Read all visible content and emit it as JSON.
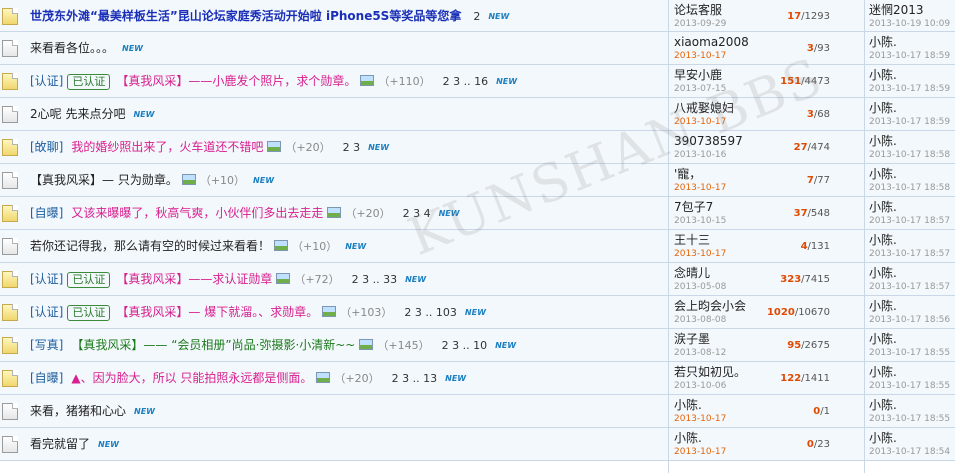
{
  "watermark": "KUNSHAN BBS",
  "threads": [
    {
      "icon": "folder-icon",
      "category": "",
      "badge": "",
      "title": "世茂东外滩“最美样板生活”昆山论坛家庭秀活动开始啦 iPhone5S等奖品等您拿",
      "title_color": "blue",
      "has_image": false,
      "replies_label": "",
      "pages": "2",
      "new": "NEW",
      "author": "论坛客服",
      "author_date": "2013-09-29",
      "author_date_hot": false,
      "reply_count": "17",
      "view_count": "1293",
      "last_user": "迷惘2013",
      "last_time": "2013-10-19 10:09"
    },
    {
      "icon": "page-icon",
      "category": "",
      "badge": "",
      "title": "来看看各位。。。",
      "title_color": "dark",
      "has_image": false,
      "replies_label": "",
      "pages": "",
      "new": "NEW",
      "author": "xiaoma2008",
      "author_date": "2013-10-17",
      "author_date_hot": true,
      "reply_count": "3",
      "view_count": "93",
      "last_user": "小陈.",
      "last_time": "2013-10-17 18:59"
    },
    {
      "icon": "folder-icon",
      "category": "[认证]",
      "badge": "已认证",
      "title": "【真我风采】——小鹿发个照片，求个勋章。",
      "title_color": "pink",
      "has_image": true,
      "replies_label": "（+110）",
      "pages": "2 3 .. 16",
      "new": "NEW",
      "author": "早安小鹿",
      "author_date": "2013-07-15",
      "author_date_hot": false,
      "reply_count": "151",
      "view_count": "4473",
      "last_user": "小陈.",
      "last_time": "2013-10-17 18:59"
    },
    {
      "icon": "page-icon",
      "category": "",
      "badge": "",
      "title": "2心呢 先来点分吧",
      "title_color": "dark",
      "has_image": false,
      "replies_label": "",
      "pages": "",
      "new": "NEW",
      "author": "八戒娶媳妇",
      "author_date": "2013-10-17",
      "author_date_hot": true,
      "reply_count": "3",
      "view_count": "68",
      "last_user": "小陈.",
      "last_time": "2013-10-17 18:59"
    },
    {
      "icon": "folder-icon",
      "category": "[敀聊]",
      "badge": "",
      "title": "我的婚纱照出来了，火车道还不错吧",
      "title_color": "pink",
      "has_image": true,
      "replies_label": "（+20）",
      "pages": "2 3",
      "new": "NEW",
      "author": "390738597",
      "author_date": "2013-10-16",
      "author_date_hot": false,
      "reply_count": "27",
      "view_count": "474",
      "last_user": "小陈.",
      "last_time": "2013-10-17 18:58"
    },
    {
      "icon": "page-icon",
      "category": "",
      "badge": "",
      "title": "【真我风采】— 只为勋章。",
      "title_color": "dark",
      "has_image": true,
      "replies_label": "（+10）",
      "pages": "",
      "new": "NEW",
      "author": "'寵，",
      "author_date": "2013-10-17",
      "author_date_hot": true,
      "reply_count": "7",
      "view_count": "77",
      "last_user": "小陈.",
      "last_time": "2013-10-17 18:58"
    },
    {
      "icon": "folder-icon",
      "category": "[自曝]",
      "badge": "",
      "title": "又该来曝曝了，秋高气爽，小伙伴们多出去走走",
      "title_color": "pink",
      "has_image": true,
      "replies_label": "（+20）",
      "pages": "2 3 4",
      "new": "NEW",
      "author": "7包子7",
      "author_date": "2013-10-15",
      "author_date_hot": false,
      "reply_count": "37",
      "view_count": "548",
      "last_user": "小陈.",
      "last_time": "2013-10-17 18:57"
    },
    {
      "icon": "page-icon",
      "category": "",
      "badge": "",
      "title": "若你还记得我，那么请有空的时候过来看看！",
      "title_color": "dark",
      "has_image": true,
      "replies_label": "（+10）",
      "pages": "",
      "new": "NEW",
      "author": "王十三",
      "author_date": "2013-10-17",
      "author_date_hot": true,
      "reply_count": "4",
      "view_count": "131",
      "last_user": "小陈.",
      "last_time": "2013-10-17 18:57"
    },
    {
      "icon": "folder-icon",
      "category": "[认证]",
      "badge": "已认证",
      "title": "【真我风采】——求认证勋章",
      "title_color": "pink",
      "has_image": true,
      "replies_label": "（+72）",
      "pages": "2 3 .. 33",
      "new": "NEW",
      "author": "念晴儿",
      "author_date": "2013-05-08",
      "author_date_hot": false,
      "reply_count": "323",
      "view_count": "7415",
      "last_user": "小陈.",
      "last_time": "2013-10-17 18:57"
    },
    {
      "icon": "folder-icon",
      "category": "[认证]",
      "badge": "已认证",
      "title": "【真我风采】— 爆下就溜。、求勋章。",
      "title_color": "pink",
      "has_image": true,
      "replies_label": "（+103）",
      "pages": "2 3 .. 103",
      "new": "NEW",
      "author": "会上昀会小会",
      "author_date": "2013-08-08",
      "author_date_hot": false,
      "reply_count": "1020",
      "view_count": "10670",
      "last_user": "小陈.",
      "last_time": "2013-10-17 18:56"
    },
    {
      "icon": "folder-icon",
      "category": "[写真]",
      "badge": "",
      "title": "【真我风采】—— “会员相册”尚品·弥摄影·小清新~~",
      "title_color": "green",
      "has_image": true,
      "replies_label": "（+145）",
      "pages": "2 3 .. 10",
      "new": "NEW",
      "author": "涙子墨",
      "author_date": "2013-08-12",
      "author_date_hot": false,
      "reply_count": "95",
      "view_count": "2675",
      "last_user": "小陈.",
      "last_time": "2013-10-17 18:55"
    },
    {
      "icon": "folder-icon",
      "category": "[自曝]",
      "badge": "",
      "title": "▲、因为脸大，所以 只能拍照永远都是侧面。",
      "title_color": "pink",
      "has_image": true,
      "replies_label": "（+20）",
      "pages": "2 3 .. 13",
      "new": "NEW",
      "author": "若只如初见。",
      "author_date": "2013-10-06",
      "author_date_hot": false,
      "reply_count": "122",
      "view_count": "1411",
      "last_user": "小陈.",
      "last_time": "2013-10-17 18:55"
    },
    {
      "icon": "page-icon",
      "category": "",
      "badge": "",
      "title": "来看，猪猪和心心",
      "title_color": "dark",
      "has_image": false,
      "replies_label": "",
      "pages": "",
      "new": "NEW",
      "author": "小陈.",
      "author_date": "2013-10-17",
      "author_date_hot": true,
      "reply_count": "0",
      "view_count": "1",
      "last_user": "小陈.",
      "last_time": "2013-10-17 18:55"
    },
    {
      "icon": "page-icon",
      "category": "",
      "badge": "",
      "title": "看完就留了",
      "title_color": "dark",
      "has_image": false,
      "replies_label": "",
      "pages": "",
      "new": "NEW",
      "author": "小陈.",
      "author_date": "2013-10-17",
      "author_date_hot": true,
      "reply_count": "0",
      "view_count": "23",
      "last_user": "小陈.",
      "last_time": "2013-10-17 18:54"
    }
  ]
}
